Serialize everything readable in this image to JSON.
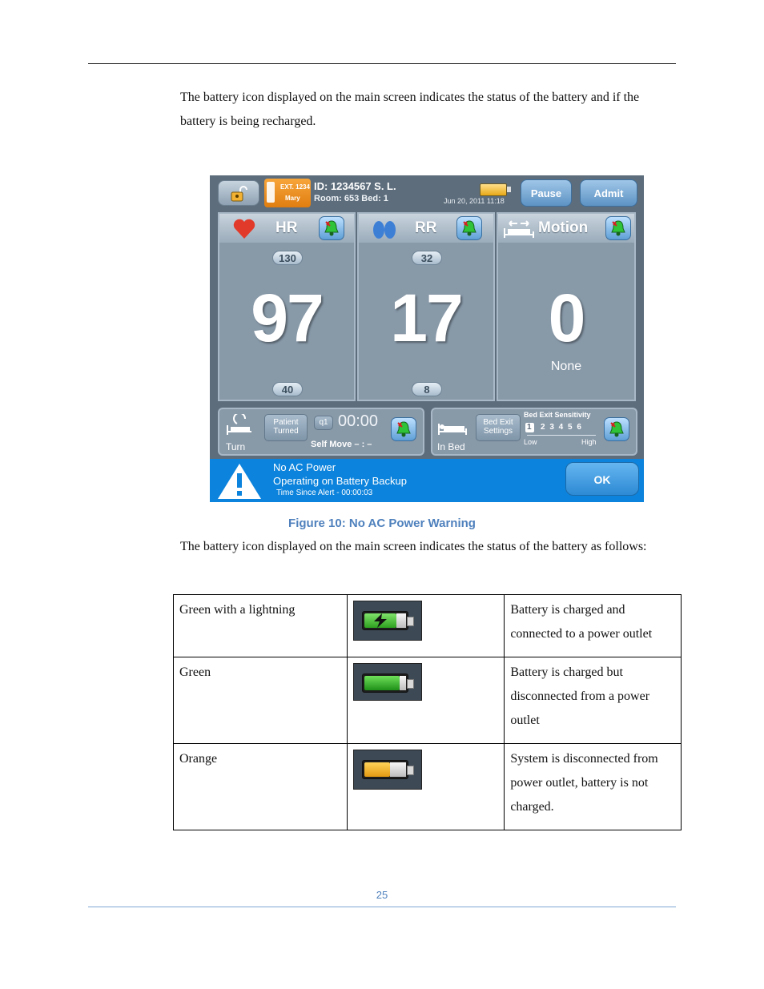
{
  "intro_text": "The battery icon displayed on the main screen indicates the status of the battery and if the battery is being recharged.",
  "screen": {
    "nurse_ext": "EXT. 1234",
    "nurse_name": "Mary",
    "patient_id": "ID: 1234567 S. L.",
    "room": "Room: 653 Bed: 1",
    "datetime": "Jun 20, 2011   11:18",
    "pause_label": "Pause",
    "admit_label": "Admit",
    "hr": {
      "title": "HR",
      "high": "130",
      "value": "97",
      "low": "40"
    },
    "rr": {
      "title": "RR",
      "high": "32",
      "value": "17",
      "low": "8"
    },
    "motion": {
      "title": "Motion",
      "value": "0",
      "status": "None"
    },
    "turn": {
      "label": "Turn",
      "patient_turned_line1": "Patient",
      "patient_turned_line2": "Turned",
      "q_label": "q1",
      "timer": "00:00",
      "self_move": "Self Move  – : –"
    },
    "bed": {
      "label": "In Bed",
      "settings_line1": "Bed Exit",
      "settings_line2": "Settings",
      "sensitivity_title": "Bed Exit Sensitivity",
      "sensitivity_first": "1",
      "sensitivity_levels": "2 3 4 5 6",
      "low": "Low",
      "high": "High"
    },
    "alert": {
      "line1": "No AC Power",
      "line2": "Operating on Battery Backup",
      "line3": "Time Since Alert  -  00:00:03",
      "ok_label": "OK"
    },
    "colors": {
      "alert_blue": "#0c83dc",
      "heart_red": "#e23a2a",
      "bell_green": "#2fc33a"
    }
  },
  "caption": "Figure 10: No AC Power Warning",
  "follows_text": "The battery icon displayed on the main screen indicates the status of the battery as follows:",
  "table": [
    {
      "color": "Green with a lightning",
      "icon": "battery-charging-icon",
      "description": "Battery is charged and connected to a power outlet"
    },
    {
      "color": "Green",
      "icon": "battery-full-icon",
      "description": "Battery is charged but disconnected from a power outlet"
    },
    {
      "color": "Orange",
      "icon": "battery-low-icon",
      "description": "System is disconnected from power outlet, battery is not charged."
    }
  ],
  "page_number": "25"
}
